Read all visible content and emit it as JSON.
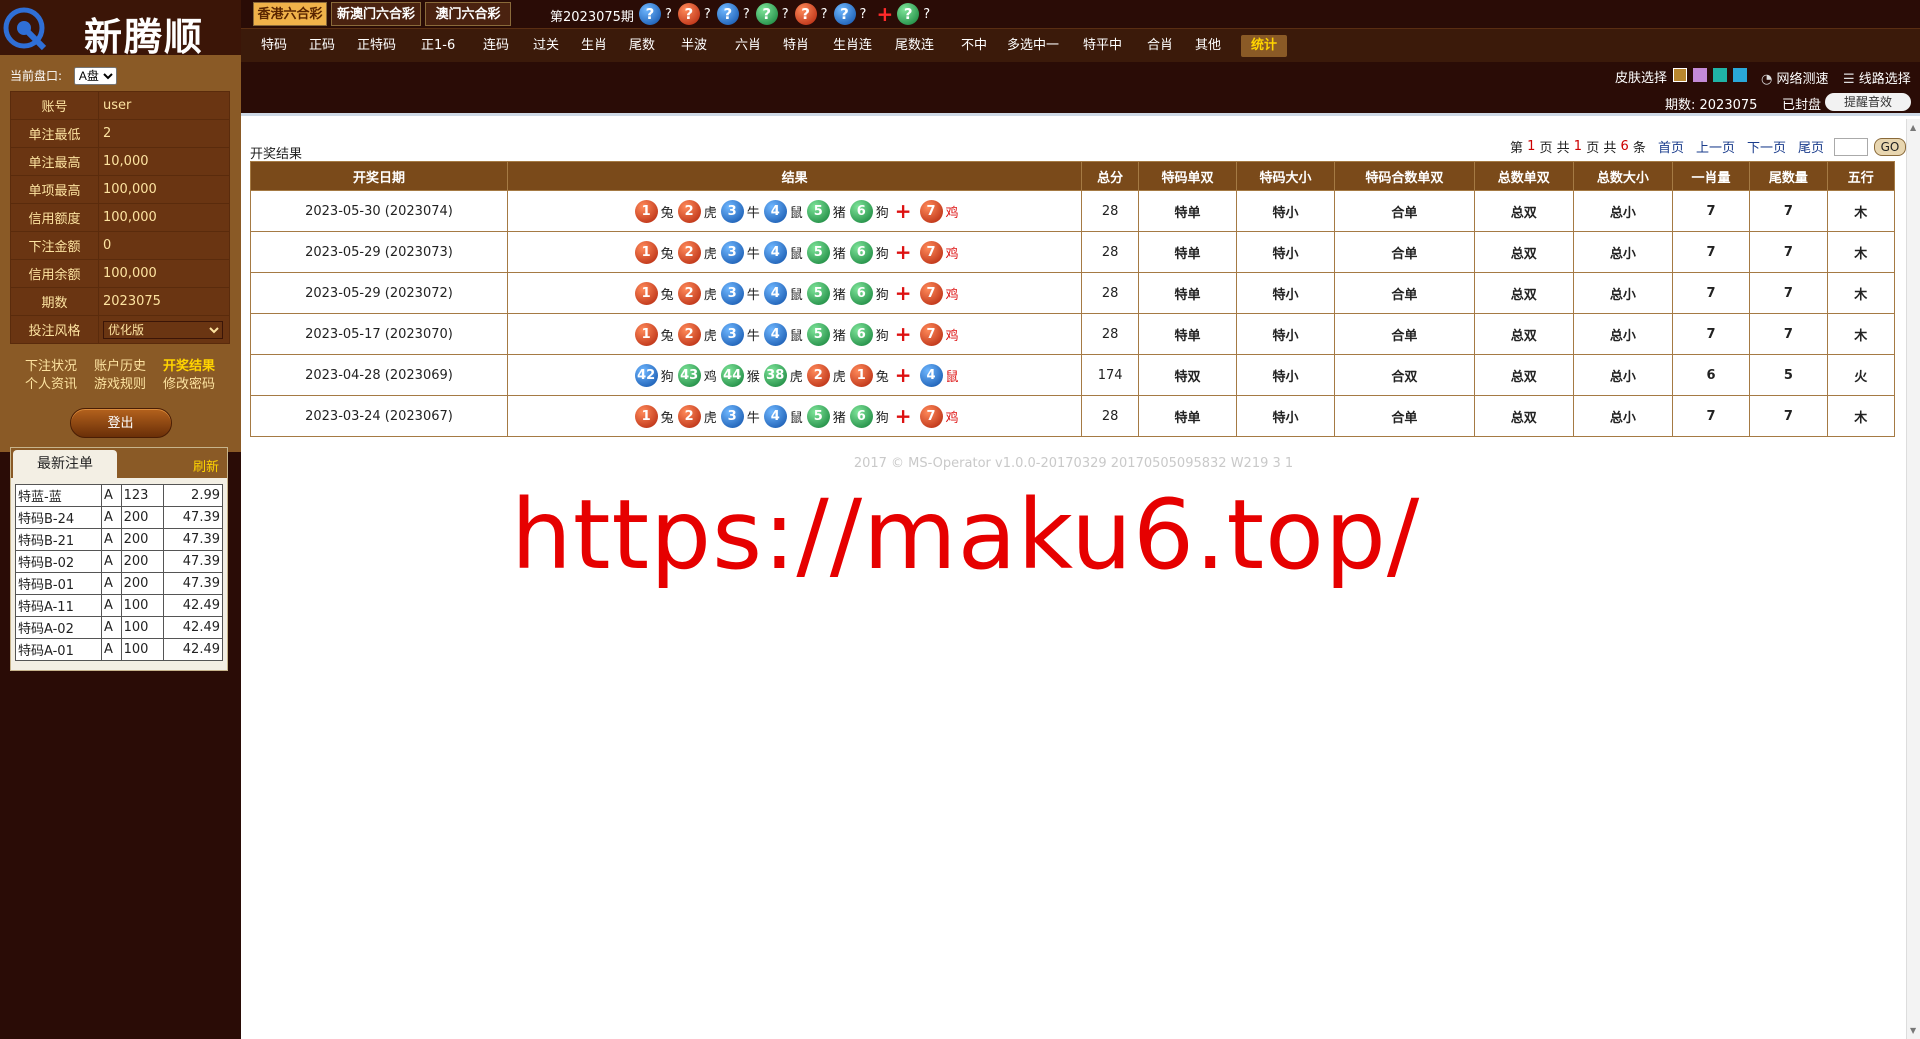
{
  "brand": {
    "name": "新腾顺"
  },
  "colors": {
    "brand_bg": "#2a0c06",
    "accent": "#f0b24a",
    "red_ball": "#b0220a",
    "blue_ball": "#0d4ea6",
    "green_ball": "#0f7c35"
  },
  "sidebar": {
    "market_label": "当前盘口:",
    "market_value": "A盘",
    "info": [
      {
        "label": "账号",
        "value": "user"
      },
      {
        "label": "单注最低",
        "value": "2"
      },
      {
        "label": "单注最高",
        "value": "10,000"
      },
      {
        "label": "单项最高",
        "value": "100,000"
      },
      {
        "label": "信用额度",
        "value": "100,000"
      },
      {
        "label": "下注金额",
        "value": "0"
      },
      {
        "label": "信用余额",
        "value": "100,000"
      },
      {
        "label": "期数",
        "value": "2023075"
      }
    ],
    "style_label": "投注风格",
    "style_value": "优化版",
    "links": [
      "下注状况",
      "账户历史",
      "开奖结果",
      "个人资讯",
      "游戏规则",
      "修改密码"
    ],
    "logout": "登出",
    "bets_tab": "最新注单",
    "bets_refresh": "刷新",
    "bets": [
      {
        "name": "特蓝-蓝",
        "plate": "A",
        "amount": "123",
        "odds": "2.99"
      },
      {
        "name": "特码B-24",
        "plate": "A",
        "amount": "200",
        "odds": "47.39"
      },
      {
        "name": "特码B-21",
        "plate": "A",
        "amount": "200",
        "odds": "47.39"
      },
      {
        "name": "特码B-02",
        "plate": "A",
        "amount": "200",
        "odds": "47.39"
      },
      {
        "name": "特码B-01",
        "plate": "A",
        "amount": "200",
        "odds": "47.39"
      },
      {
        "name": "特码A-11",
        "plate": "A",
        "amount": "100",
        "odds": "42.49"
      },
      {
        "name": "特码A-02",
        "plate": "A",
        "amount": "100",
        "odds": "42.49"
      },
      {
        "name": "特码A-01",
        "plate": "A",
        "amount": "100",
        "odds": "42.49"
      }
    ]
  },
  "topbar": {
    "lottery_tabs": [
      "香港六合彩",
      "新澳门六合彩",
      "澳门六合彩"
    ],
    "period_label": "第2023075期",
    "q_mark": "?",
    "q_symbol": "?"
  },
  "nav": [
    "特码",
    "正码",
    "正特码",
    "正1-6",
    "连码",
    "过关",
    "生肖",
    "尾数",
    "半波",
    "六肖",
    "特肖",
    "生肖连",
    "尾数连",
    "不中",
    "多选中一",
    "特平中",
    "合肖",
    "其他",
    "统计"
  ],
  "toolbar": {
    "skin_label": "皮肤选择",
    "network_test": "网络测速",
    "route_select": "线路选择",
    "period_text": "期数: 2023075",
    "closed_text": "已封盘",
    "sound_button": "提醒音效"
  },
  "results": {
    "title": "开奖结果",
    "pager": {
      "prefix": "第",
      "page": "1",
      "mid1": "页 共",
      "total_pages": "1",
      "mid2": "页 共",
      "total_items": "6",
      "suffix": "条",
      "first": "首页",
      "prev": "上一页",
      "next": "下一页",
      "last": "尾页",
      "go": "GO"
    },
    "columns": [
      "开奖日期",
      "结果",
      "总分",
      "特码单双",
      "特码大小",
      "特码合数单双",
      "总数单双",
      "总数大小",
      "一肖量",
      "尾数量",
      "五行"
    ],
    "rows": [
      {
        "date": "2023-05-30 (2023074)",
        "balls": [
          [
            "1",
            "red",
            "兔"
          ],
          [
            "2",
            "red",
            "虎"
          ],
          [
            "3",
            "blue",
            "牛"
          ],
          [
            "4",
            "blue",
            "鼠"
          ],
          [
            "5",
            "green",
            "猪"
          ],
          [
            "6",
            "green",
            "狗"
          ]
        ],
        "special": [
          "7",
          "red",
          "鸡"
        ],
        "total": "28",
        "t_ds": "特单",
        "t_dx": "特小",
        "t_hds": "合单",
        "z_ds": "总双",
        "z_dx": "总小",
        "yx": "7",
        "ws": "7",
        "wx": "木"
      },
      {
        "date": "2023-05-29 (2023073)",
        "balls": [
          [
            "1",
            "red",
            "兔"
          ],
          [
            "2",
            "red",
            "虎"
          ],
          [
            "3",
            "blue",
            "牛"
          ],
          [
            "4",
            "blue",
            "鼠"
          ],
          [
            "5",
            "green",
            "猪"
          ],
          [
            "6",
            "green",
            "狗"
          ]
        ],
        "special": [
          "7",
          "red",
          "鸡"
        ],
        "total": "28",
        "t_ds": "特单",
        "t_dx": "特小",
        "t_hds": "合单",
        "z_ds": "总双",
        "z_dx": "总小",
        "yx": "7",
        "ws": "7",
        "wx": "木"
      },
      {
        "date": "2023-05-29 (2023072)",
        "balls": [
          [
            "1",
            "red",
            "兔"
          ],
          [
            "2",
            "red",
            "虎"
          ],
          [
            "3",
            "blue",
            "牛"
          ],
          [
            "4",
            "blue",
            "鼠"
          ],
          [
            "5",
            "green",
            "猪"
          ],
          [
            "6",
            "green",
            "狗"
          ]
        ],
        "special": [
          "7",
          "red",
          "鸡"
        ],
        "total": "28",
        "t_ds": "特单",
        "t_dx": "特小",
        "t_hds": "合单",
        "z_ds": "总双",
        "z_dx": "总小",
        "yx": "7",
        "ws": "7",
        "wx": "木"
      },
      {
        "date": "2023-05-17 (2023070)",
        "balls": [
          [
            "1",
            "red",
            "兔"
          ],
          [
            "2",
            "red",
            "虎"
          ],
          [
            "3",
            "blue",
            "牛"
          ],
          [
            "4",
            "blue",
            "鼠"
          ],
          [
            "5",
            "green",
            "猪"
          ],
          [
            "6",
            "green",
            "狗"
          ]
        ],
        "special": [
          "7",
          "red",
          "鸡"
        ],
        "total": "28",
        "t_ds": "特单",
        "t_dx": "特小",
        "t_hds": "合单",
        "z_ds": "总双",
        "z_dx": "总小",
        "yx": "7",
        "ws": "7",
        "wx": "木"
      },
      {
        "date": "2023-04-28 (2023069)",
        "balls": [
          [
            "42",
            "blue",
            "狗"
          ],
          [
            "43",
            "green",
            "鸡"
          ],
          [
            "44",
            "green",
            "猴"
          ],
          [
            "38",
            "green",
            "虎"
          ],
          [
            "2",
            "red",
            "虎"
          ],
          [
            "1",
            "red",
            "兔"
          ]
        ],
        "special": [
          "4",
          "blue",
          "鼠"
        ],
        "total": "174",
        "t_ds": "特双",
        "t_dx": "特小",
        "t_hds": "合双",
        "z_ds": "总双",
        "z_dx": "总小",
        "yx": "6",
        "ws": "5",
        "wx": "火"
      },
      {
        "date": "2023-03-24 (2023067)",
        "balls": [
          [
            "1",
            "red",
            "兔"
          ],
          [
            "2",
            "red",
            "虎"
          ],
          [
            "3",
            "blue",
            "牛"
          ],
          [
            "4",
            "blue",
            "鼠"
          ],
          [
            "5",
            "green",
            "猪"
          ],
          [
            "6",
            "green",
            "狗"
          ]
        ],
        "special": [
          "7",
          "red",
          "鸡"
        ],
        "total": "28",
        "t_ds": "特单",
        "t_dx": "特小",
        "t_hds": "合单",
        "z_ds": "总双",
        "z_dx": "总小",
        "yx": "7",
        "ws": "7",
        "wx": "木"
      }
    ]
  },
  "footer": {
    "version": "2017 © MS-Operator v1.0.0-20170329 20170505095832 W219 3 1"
  },
  "watermark": "https://maku6.top/"
}
